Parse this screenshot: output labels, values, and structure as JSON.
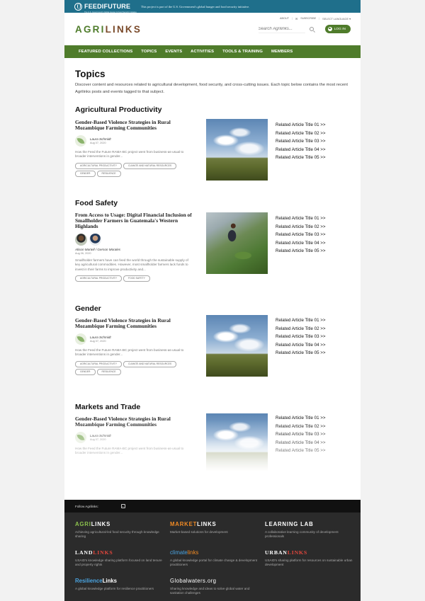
{
  "top_bar": {
    "logo_text": "FEEDIFUTURE",
    "logo_sub": "The U.S. Government's Global Hunger & Food Security Initiative",
    "note": "This project is part of the U.S. Government's global hunger and food security initiative."
  },
  "util_nav": {
    "about": "ABOUT",
    "subscribe": "SUBSCRIBE",
    "language": "SELECT LANGUAGE ▾"
  },
  "brand": {
    "agri": "AGRI",
    "links": "LINKS"
  },
  "search": {
    "placeholder": "Search Agrilinks..."
  },
  "login_label": "LOG IN",
  "nav": [
    "FEATURED COLLECTIONS",
    "TOPICS",
    "EVENTS",
    "ACTIVITIES",
    "TOOLS & TRAINING",
    "MEMBERS"
  ],
  "page": {
    "title": "Topics",
    "intro": "Discover content and resources related to agricultural development, food security, and cross-cutting issues. Each topic below contains the most recent Agrilinks posts and events tagged to that subject."
  },
  "sections": [
    {
      "title": "Agricultural Productivity",
      "article_title": "Gender-Based Violence Strategies in Rural Mozambique Farming Communities",
      "author": "Laura Schmidt",
      "date": "Aug 07, 2020",
      "excerpt": "How the Feed the Future RAMA-BC project went from business-as-usual to broader interventions in gender...",
      "tags": [
        "AGRICULTURAL PRODUCTIVITY",
        "CLIMATE AND NATURAL RESOURCES",
        "GENDER",
        "RESILIENCE"
      ],
      "related": [
        "Related Article Title 01 >>",
        "Related Article Title 02 >>",
        "Related Article Title 03 >>",
        "Related Article Title 04 >>",
        "Related Article Title 05 >>"
      ]
    },
    {
      "title": "Food Safety",
      "article_title": "From Access to Usage: Digital Financial Inclusion of Smallholder Farmers in Guatemala's Western Highlands",
      "author": "Alison Martell / Gerson Morales",
      "date": "Aug 06, 2020",
      "excerpt": "Smallholder farmers have can feed the world through the sustainable supply of key agricultural commodities. However, most smallholder farmers lack funds to invest in their farms to improve productivity and...",
      "tags": [
        "AGRICULTURAL PRODUCTIVITY",
        "FOOD SAFETY"
      ],
      "related": [
        "Related Article Title 01 >>",
        "Related Article Title 02 >>",
        "Related Article Title 03 >>",
        "Related Article Title 04 >>",
        "Related Article Title 05 >>"
      ]
    },
    {
      "title": "Gender",
      "article_title": "Gender-Based Violence Strategies in Rural Mozambique Farming Communities",
      "author": "Laura Schmidt",
      "date": "Aug 07, 2020",
      "excerpt": "How the Feed the Future RAMA-BC project went from business-as-usual to broader interventions in gender...",
      "tags": [
        "AGRICULTURAL PRODUCTIVITY",
        "CLIMATE AND NATURAL RESOURCES",
        "GENDER",
        "RESILIENCE"
      ],
      "related": [
        "Related Article Title 01 >>",
        "Related Article Title 02 >>",
        "Related Article Title 03 >>",
        "Related Article Title 04 >>",
        "Related Article Title 05 >>"
      ]
    },
    {
      "title": "Markets and Trade",
      "article_title": "Gender-Based Violence Strategies in Rural Mozambique Farming Communities",
      "author": "Laura Schmidt",
      "date": "Aug 07, 2020",
      "excerpt": "How the Feed the Future RAMA-BC project went from business-as-usual to broader interventions in gender...",
      "related": [
        "Related Article Title 01 >>",
        "Related Article Title 02 >>",
        "Related Article Title 03 >>",
        "Related Article Title 04 >>",
        "Related Article Title 05 >>"
      ]
    }
  ],
  "footer": {
    "follow_label": "Follow Agrilinks:",
    "partners": [
      {
        "logo_a": "AGRI",
        "logo_b": "LINKS",
        "desc": "Achieving agricultural-led food security through knowledge sharing"
      },
      {
        "logo_a": "MARKET",
        "logo_b": "LINKS",
        "desc": "Market-based solutions for development"
      },
      {
        "logo_a": "LEARNING",
        "logo_b": " LAB",
        "desc": "A collaborative learning community of development professionals"
      },
      {
        "logo_a": "LAND",
        "logo_b": "LINKS",
        "desc": "USAID's knowledge sharing platform focused on land tenure and property rights"
      },
      {
        "logo_a": "climate",
        "logo_b": "links",
        "desc": "A global knowledge portal for climate change & development practitioners"
      },
      {
        "logo_a": "URBAN",
        "logo_b": "LINKS",
        "desc": "USAID's sharing platform for resources on sustainable urban development"
      },
      {
        "logo_a": "Resilience",
        "logo_b": "Links",
        "desc": "A global knowledge platform for resilience practitioners"
      },
      {
        "logo_a": "Globalwaters",
        "logo_b": ".org",
        "desc": "Sharing knowledge and ideas to solve global water and sanitation challenges"
      }
    ]
  }
}
